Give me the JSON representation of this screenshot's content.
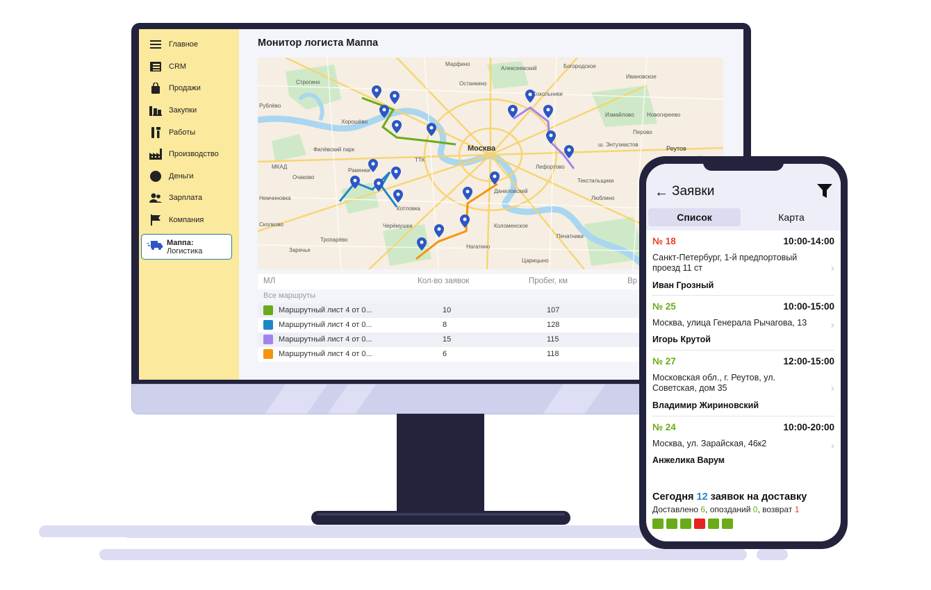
{
  "desktop": {
    "title": "Монитор логиста Маппа",
    "sidebar": {
      "items": [
        {
          "label": "Главное",
          "icon": "hamburger-icon"
        },
        {
          "label": "CRM",
          "icon": "crm-icon"
        },
        {
          "label": "Продажи",
          "icon": "shopping-bag-icon"
        },
        {
          "label": "Закупки",
          "icon": "purchases-icon"
        },
        {
          "label": "Работы",
          "icon": "tools-icon"
        },
        {
          "label": "Производство",
          "icon": "factory-icon"
        },
        {
          "label": "Деньги",
          "icon": "coin-icon"
        },
        {
          "label": "Зарплата",
          "icon": "people-icon"
        },
        {
          "label": "Компания",
          "icon": "flag-icon"
        }
      ],
      "active_line1": "Маппа:",
      "active_line2": "Логистика",
      "active_icon": "truck-icon"
    },
    "map": {
      "labels": [
        "Москва",
        "Реутов",
        "Немчиновка",
        "Заречье",
        "Сколково",
        "Сокольники",
        "Измайлово",
        "Лефортово",
        "Коломенское",
        "Рублёво",
        "Строгино",
        "Хорошёво",
        "Филёвский парк",
        "Алексеевский",
        "Богородское",
        "Перово",
        "Новогиреево",
        "ш. Энтузиастов",
        "Ивановское",
        "Люблино",
        "Печатники",
        "Нагатино",
        "Котловка",
        "Черёмушки",
        "Раменки",
        "Очаково",
        "Тропарёво",
        "Царицыно",
        "Даниловский",
        "Текстильщики",
        "Марфино",
        "Останкино",
        "ТТК",
        "МКАД"
      ],
      "route_colors": [
        "#6aab19",
        "#1f86c9",
        "#a185ef",
        "#f5940f"
      ],
      "pin_color": "#2c56c4"
    },
    "table": {
      "headers": [
        "МЛ",
        "Кол-во заявок",
        "Пробег, км",
        "Вр"
      ],
      "all_routes": "Все маршруты",
      "rows": [
        {
          "name": "Маршрутный лист 4 от 0...",
          "count": "10",
          "km": "107",
          "color": "#6aab19"
        },
        {
          "name": "Маршрутный лист 4 от 0...",
          "count": "8",
          "km": "128",
          "color": "#1f86c9"
        },
        {
          "name": "Маршрутный лист 4 от 0...",
          "count": "15",
          "km": "115",
          "color": "#a185ef"
        },
        {
          "name": "Маршрутный лист 4 от 0...",
          "count": "6",
          "km": "118",
          "color": "#f5940f"
        }
      ]
    }
  },
  "phone": {
    "back": "←",
    "title": "Заявки",
    "tab_list": "Список",
    "tab_map": "Карта",
    "orders": [
      {
        "num": "№ 18",
        "num_color": "#e8402a",
        "time": "10:00-14:00",
        "addr": "Санкт-Петербург, 1-й предпортовый проезд 11 ст",
        "who": "Иван Грозный"
      },
      {
        "num": "№ 25",
        "num_color": "#6aab19",
        "time": "10:00-15:00",
        "addr": "Москва, улица Генерала Рычагова, 13",
        "who": "Игорь Крутой"
      },
      {
        "num": "№ 27",
        "num_color": "#6aab19",
        "time": "12:00-15:00",
        "addr": "Московская обл., г. Реутов, ул. Советская, дом 35",
        "who": "Владимир Жириновский"
      },
      {
        "num": "№ 24",
        "num_color": "#6aab19",
        "time": "10:00-20:00",
        "addr": "Москва, ул. Зарайская, 46к2",
        "who": "Анжелика Варум"
      }
    ],
    "summary": {
      "pre": "Сегодня ",
      "count": "12",
      "post": " заявок на доставку",
      "delivered_label": "Доставлено ",
      "delivered": "6",
      "late_label": ", опозданий ",
      "late": "0",
      "returned_label": ", возврат ",
      "returned": "1"
    },
    "progress_blocks": [
      "done",
      "done",
      "done",
      "returned",
      "done",
      "done",
      "pending",
      "pending",
      "pending",
      "pending",
      "pending",
      "pending"
    ],
    "colors": {
      "done": "#6aab19",
      "returned": "#e62222",
      "pending": "#ffffff",
      "count": "#1f86c9"
    }
  }
}
